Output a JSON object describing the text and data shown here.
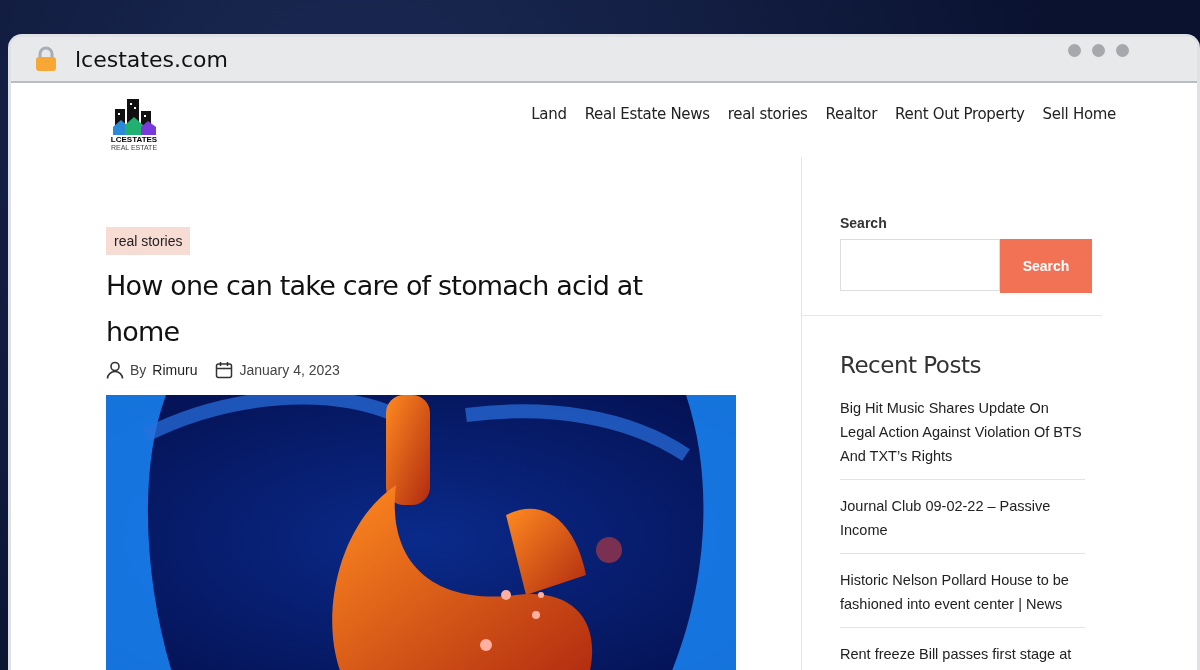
{
  "browser": {
    "url": "lcestates.com"
  },
  "site": {
    "logo_name": "LCESTATES",
    "logo_tagline": "REAL ESTATE",
    "nav": [
      {
        "label": "Land"
      },
      {
        "label": "Real Estate News"
      },
      {
        "label": "real stories"
      },
      {
        "label": "Realtor"
      },
      {
        "label": "Rent Out Property"
      },
      {
        "label": "Sell Home"
      }
    ]
  },
  "article": {
    "category": "real stories",
    "title": "How one can take care of stomach acid at home",
    "by": "By",
    "author": "Rimuru",
    "date": "January 4, 2023"
  },
  "sidebar": {
    "search_label": "Search",
    "search_button": "Search",
    "recent_title": "Recent Posts",
    "recent_posts": [
      "Big Hit Music Shares Update On Legal Action Against Violation Of BTS And TXT’s Rights",
      "Journal Club 09-02-22 – Passive Income",
      "Historic Nelson Pollard House to be fashioned into event center | News",
      "Rent freeze Bill passes first stage at"
    ]
  }
}
